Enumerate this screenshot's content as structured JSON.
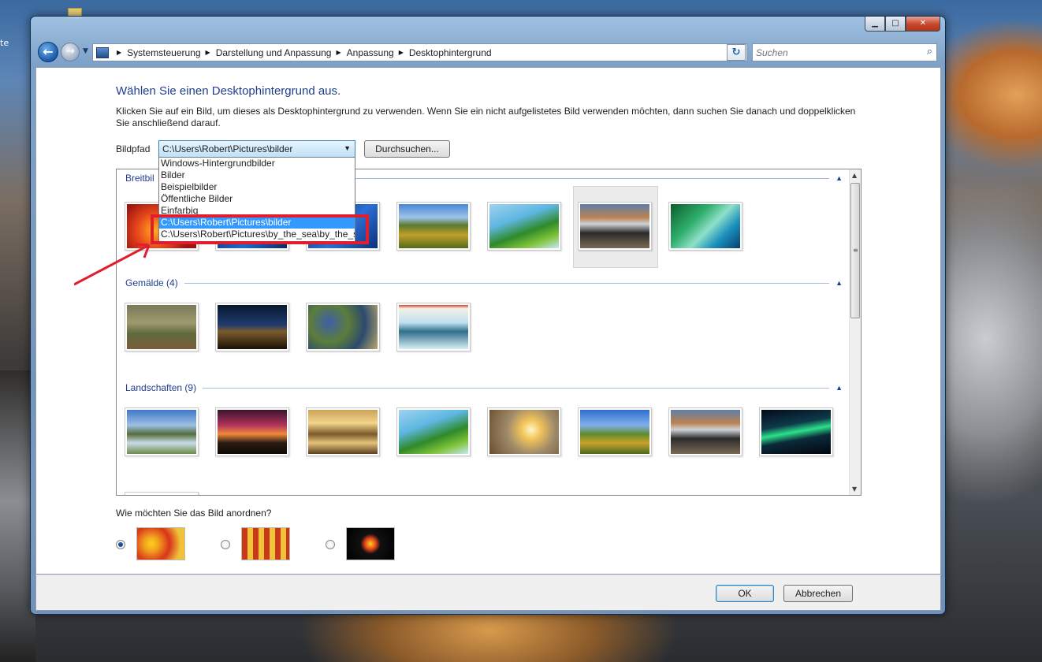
{
  "desktop": {
    "label": "te"
  },
  "window": {
    "title_buttons": {
      "minimize": "▁",
      "maximize": "□",
      "close": "✕"
    },
    "nav": {
      "back": "←",
      "forward": "→"
    },
    "breadcrumb": [
      "Systemsteuerung",
      "Darstellung und Anpassung",
      "Anpassung",
      "Desktophintergrund"
    ],
    "search": {
      "placeholder": "Suchen"
    }
  },
  "main": {
    "heading": "Wählen Sie einen Desktophintergrund aus.",
    "description": "Klicken Sie auf ein Bild, um dieses als Desktophintergrund zu verwenden. Wenn Sie ein nicht aufgelistetes Bild verwenden möchten, dann suchen Sie danach und doppelklicken Sie anschließend darauf.",
    "bildpfad_label": "Bildpfad",
    "bildpfad_value": "C:\\Users\\Robert\\Pictures\\bilder",
    "browse_label": "Durchsuchen...",
    "dropdown_options": [
      "Windows-Hintergrundbilder",
      "Bilder",
      "Beispielbilder",
      "Öffentliche Bilder",
      "Einfarbig",
      "C:\\Users\\Robert\\Pictures\\bilder",
      "C:\\Users\\Robert\\Pictures\\by_the_sea\\by_the_se"
    ],
    "groups": [
      {
        "label": "Breitbil"
      },
      {
        "label": "Gemälde (4)"
      },
      {
        "label": "Landschaften (9)"
      }
    ],
    "arrange_label": "Wie möchten Sie das Bild anordnen?",
    "arrange_selected": 0
  },
  "footer": {
    "ok": "OK",
    "cancel": "Abbrechen"
  }
}
